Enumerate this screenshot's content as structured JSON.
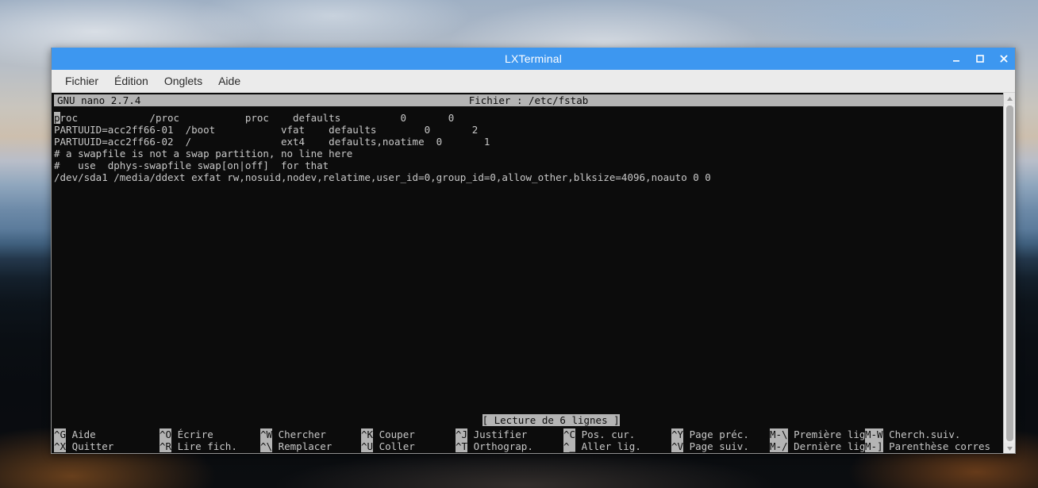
{
  "desktop": {
    "wallpaper_description": "sky-with-clouds-over-dark-road"
  },
  "window": {
    "title": "LXTerminal",
    "titlebar_color": "#3d97f0",
    "controls": [
      {
        "name": "minimize-button",
        "glyph": "_"
      },
      {
        "name": "maximize-button",
        "glyph": "□"
      },
      {
        "name": "close-button",
        "glyph": "✕"
      }
    ]
  },
  "menubar": {
    "items": [
      {
        "label": "Fichier"
      },
      {
        "label": "Édition"
      },
      {
        "label": "Onglets"
      },
      {
        "label": "Aide"
      }
    ]
  },
  "nano": {
    "version_label": "GNU nano 2.7.4",
    "file_label": "Fichier : /etc/fstab",
    "cursor_char": "p",
    "lines": [
      "roc            /proc           proc    defaults          0       0",
      "PARTUUID=acc2ff66-01  /boot           vfat    defaults        0       2",
      "PARTUUID=acc2ff66-02  /               ext4    defaults,noatime  0       1",
      "# a swapfile is not a swap partition, no line here",
      "#   use  dphys-swapfile swap[on|off]  for that",
      "/dev/sda1 /media/ddext exfat rw,nosuid,nodev,relatime,user_id=0,group_id=0,allow_other,blksize=4096,noauto 0 0"
    ],
    "status_message": "[ Lecture de 6 lignes ]",
    "shortcuts_row1": [
      {
        "key": "^G",
        "label": " Aide"
      },
      {
        "key": "^O",
        "label": " Écrire"
      },
      {
        "key": "^W",
        "label": " Chercher"
      },
      {
        "key": "^K",
        "label": " Couper"
      },
      {
        "key": "^J",
        "label": " Justifier"
      },
      {
        "key": "^C",
        "label": " Pos. cur."
      },
      {
        "key": "^Y",
        "label": " Page préc."
      },
      {
        "key": "M-\\",
        "label": " Première lig"
      },
      {
        "key": "M-W",
        "label": " Cherch.suiv."
      }
    ],
    "shortcuts_row2": [
      {
        "key": "^X",
        "label": " Quitter"
      },
      {
        "key": "^R",
        "label": " Lire fich."
      },
      {
        "key": "^\\",
        "label": " Remplacer"
      },
      {
        "key": "^U",
        "label": " Coller"
      },
      {
        "key": "^T",
        "label": " Orthograp."
      },
      {
        "key": "^_",
        "label": " Aller lig."
      },
      {
        "key": "^V",
        "label": " Page suiv."
      },
      {
        "key": "M-/",
        "label": " Dernière lig"
      },
      {
        "key": "M-]",
        "label": " Parenthèse corres"
      }
    ]
  },
  "scrollbar": {
    "up_arrow": "▲",
    "down_arrow": "▼"
  },
  "colors": {
    "titlebar": "#3d97f0",
    "menubar": "#ebebeb",
    "terminal_bg": "#0c0c0c",
    "terminal_fg": "#c8c8c8",
    "inverse_bg": "#b4b4b4"
  }
}
